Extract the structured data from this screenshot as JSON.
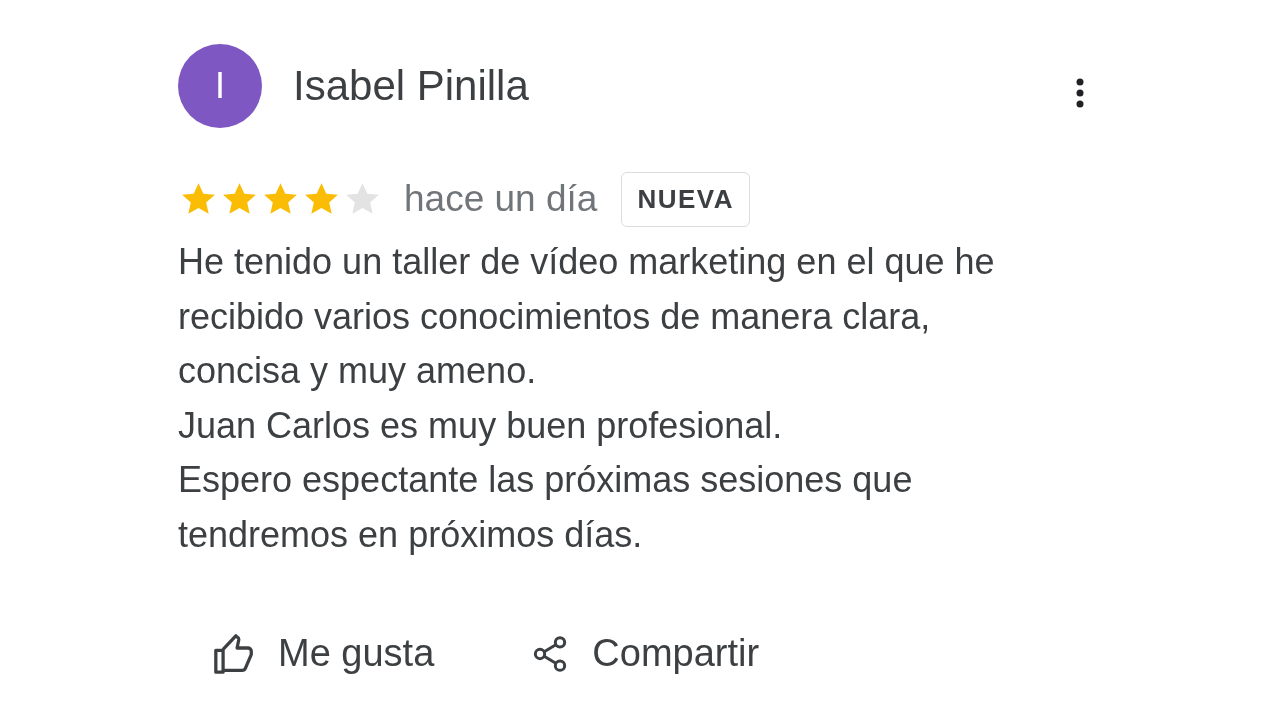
{
  "review": {
    "author": "Isabel Pinilla",
    "avatar_letter": "I",
    "stars": 4,
    "time": "hace un día",
    "badge": "NUEVA",
    "paragraphs": [
      "He tenido un taller de vídeo marketing en el que he recibido varios conocimientos de manera clara, concisa y muy ameno.",
      "Juan Carlos es muy buen profesional.",
      "Espero espectante las próximas sesiones que tendremos en próximos días."
    ],
    "actions": [
      {
        "kind": "like",
        "label": "Me gusta"
      },
      {
        "kind": "share",
        "label": "Compartir"
      }
    ]
  }
}
